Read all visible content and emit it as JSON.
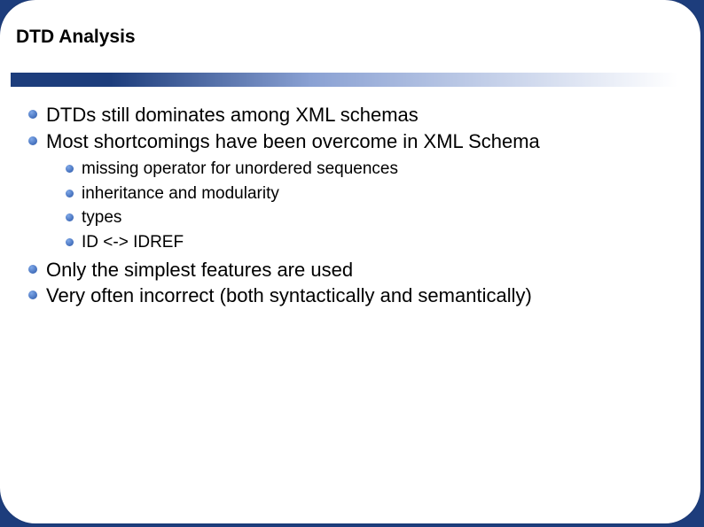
{
  "slide": {
    "title": "DTD Analysis",
    "bullets": [
      {
        "text": "DTDs still dominates among XML schemas"
      },
      {
        "text": "Most shortcomings have been overcome in XML Schema",
        "children": [
          {
            "text": "missing operator for unordered sequences"
          },
          {
            "text": "inheritance and modularity"
          },
          {
            "text": "types"
          },
          {
            "text": "ID <-> IDREF"
          }
        ]
      },
      {
        "text": "Only the simplest features are used"
      },
      {
        "text": "Very often incorrect (both syntactically and semantically)"
      }
    ]
  }
}
